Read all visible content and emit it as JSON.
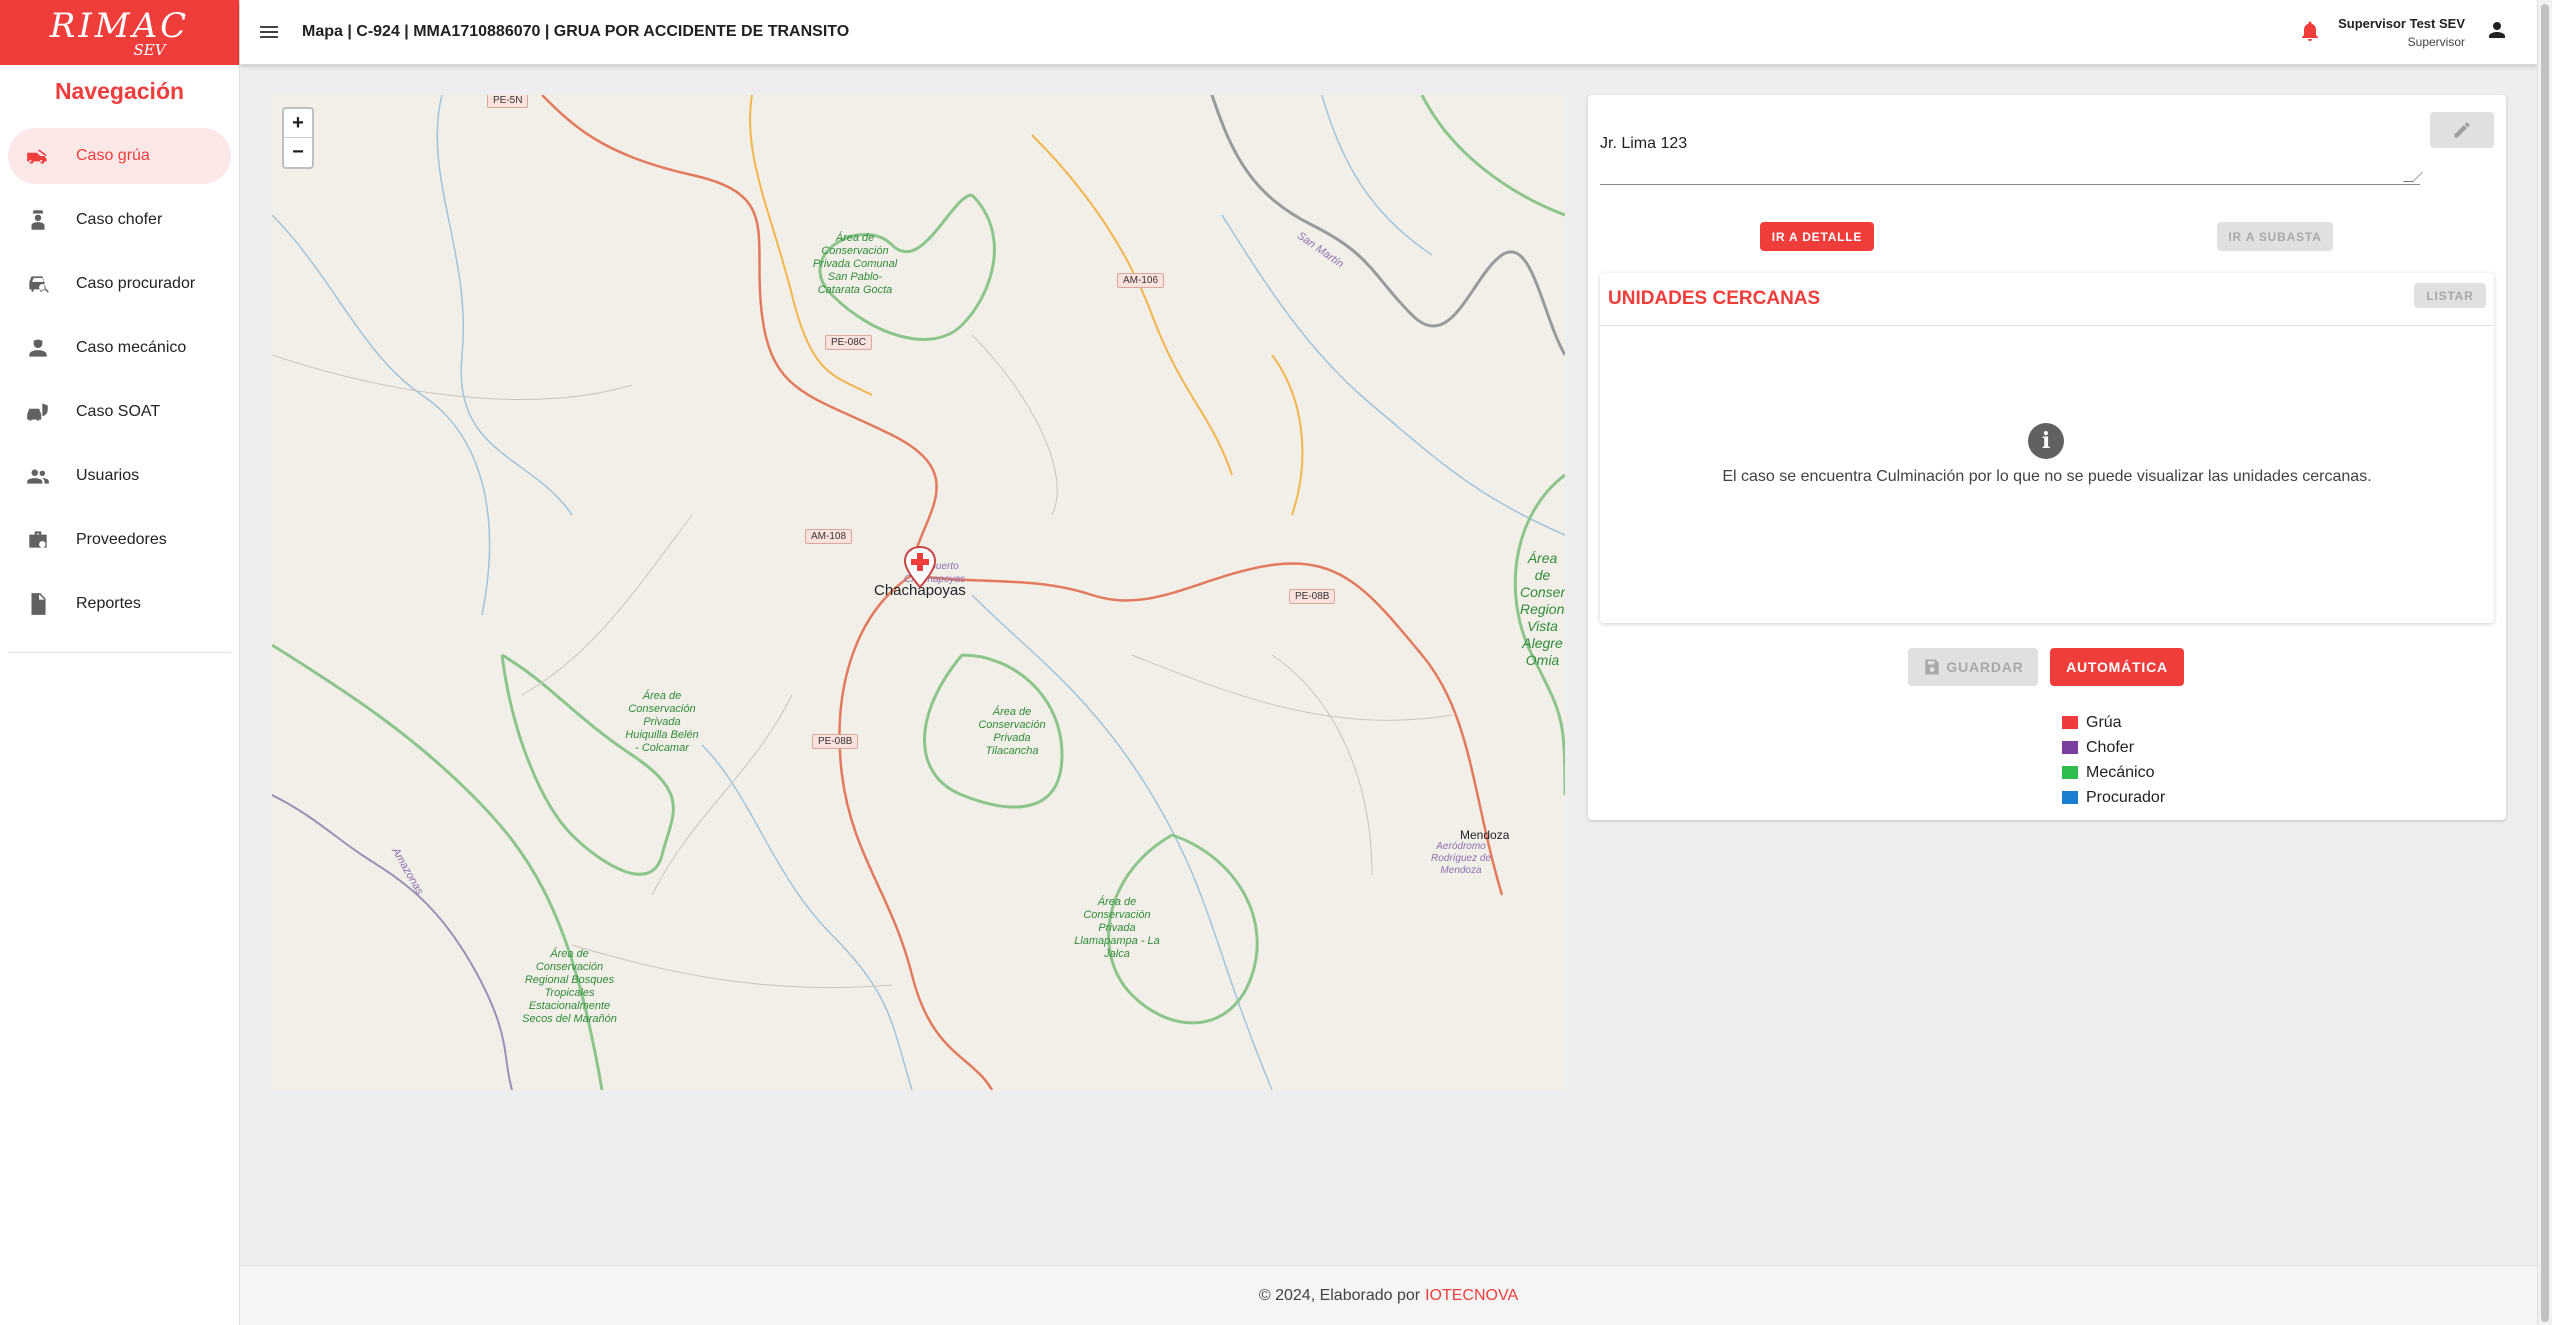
{
  "logo": {
    "main": "RIMAC",
    "sub": "SEV"
  },
  "sidebar": {
    "title": "Navegación",
    "items": [
      {
        "label": "Caso grúa",
        "icon": "tow-truck-icon",
        "active": true
      },
      {
        "label": "Caso chofer",
        "icon": "chauffeur-icon",
        "active": false
      },
      {
        "label": "Caso procurador",
        "icon": "car-search-icon",
        "active": false
      },
      {
        "label": "Caso mecánico",
        "icon": "mechanic-icon",
        "active": false
      },
      {
        "label": "Caso SOAT",
        "icon": "insurance-car-icon",
        "active": false
      },
      {
        "label": "Usuarios",
        "icon": "users-icon",
        "active": false
      },
      {
        "label": "Proveedores",
        "icon": "providers-icon",
        "active": false
      },
      {
        "label": "Reportes",
        "icon": "report-icon",
        "active": false
      }
    ]
  },
  "header": {
    "title": "Mapa | C-924 | MMA1710886070 | GRUA POR ACCIDENTE DE TRANSITO",
    "user_name": "Supervisor Test SEV",
    "user_role": "Supervisor"
  },
  "map": {
    "zoom_in": "+",
    "zoom_out": "−",
    "city": "Chachapoyas",
    "airport": "Aeropuerto Chachapoyas",
    "town_mendoza": "Mendoza",
    "airport_mendoza": "Aeródromo Rodríguez de Mendoza",
    "river": "San Martín",
    "river2": "Amazonas",
    "shields": [
      "PE-5N",
      "AM-106",
      "PE-08C",
      "AM-108",
      "PE-08B",
      "PE-08B"
    ],
    "areas": [
      "Área de Conservación Privada Comunal San Pablo-Catarata Gocta",
      "Área de Conservación Privada Huiquilla Belén - Colcamar",
      "Área de Conservación Privada Tilacancha",
      "Área de Conservación Privada Llamapampa - La Jalca",
      "Área de Conservación Regional Bosques Tropicales Estacionalmente Secos del Marañón",
      "Área de Conservación Regional Vista Alegre Omia"
    ]
  },
  "panel": {
    "address": "Jr. Lima 123",
    "btn_detail": "IR A DETALLE",
    "btn_auction": "IR A SUBASTA",
    "units_title": "UNIDADES CERCANAS",
    "btn_list": "LISTAR",
    "info_message": "El caso se encuentra Culminación por lo que no se puede visualizar las unidades cercanas.",
    "btn_save": "GUARDAR",
    "btn_auto": "AUTOMÁTICA",
    "legend": [
      {
        "label": "Grúa",
        "color": "#ef3b3b"
      },
      {
        "label": "Chofer",
        "color": "#7b3fa0"
      },
      {
        "label": "Mecánico",
        "color": "#2ebd4e"
      },
      {
        "label": "Procurador",
        "color": "#1a7fd0"
      }
    ]
  },
  "footer": {
    "text": "© 2024, Elaborado por",
    "brand": "IOTECNOVA"
  }
}
